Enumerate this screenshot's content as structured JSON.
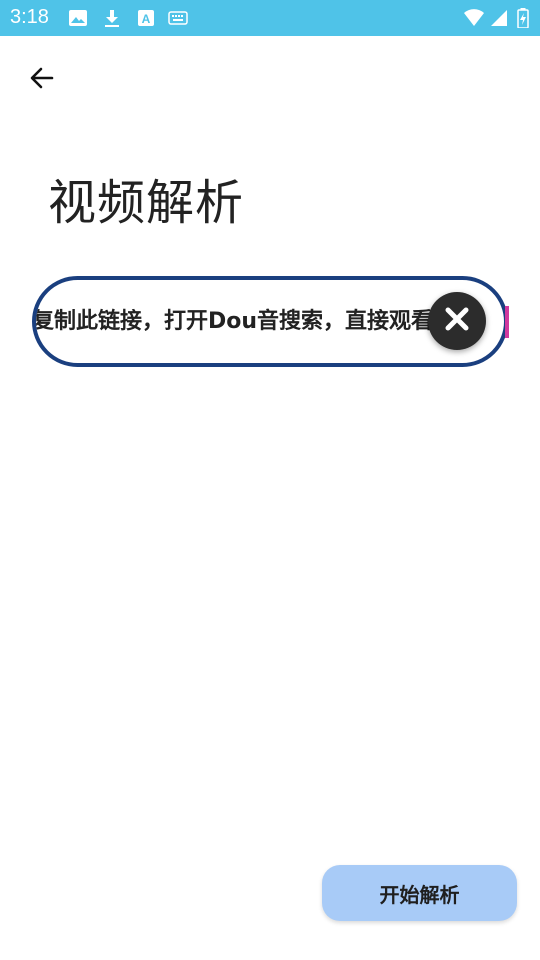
{
  "status_bar": {
    "time": "3:18",
    "icons_left": [
      "image-icon",
      "download-icon",
      "font-icon",
      "keyboard-icon"
    ],
    "icons_right": [
      "wifi-icon",
      "signal-icon",
      "battery-charging-icon"
    ],
    "color": "#4fc3e8"
  },
  "header": {
    "back_icon": "arrow-left-icon",
    "title": "视频解析"
  },
  "link_input": {
    "value": "复制此链接，打开Dou音搜索，直接观看视频！"
  },
  "clear_icon": "close-icon",
  "start_button": {
    "label": "开始解析"
  }
}
